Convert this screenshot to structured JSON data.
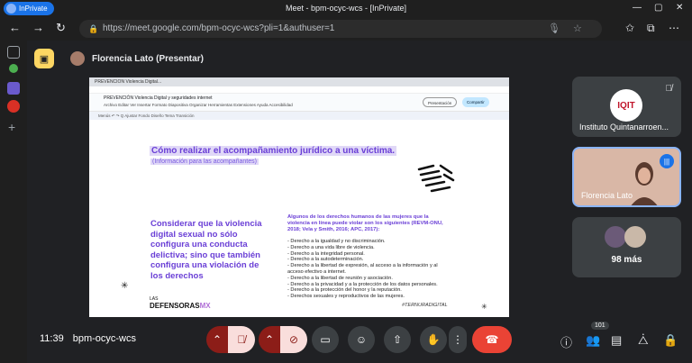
{
  "browser": {
    "inprivate_label": "InPrivate",
    "window_title": "Meet - bpm-ocyc-wcs - [InPrivate]",
    "url": "https://meet.google.com/bpm-ocyc-wcs?pli=1&authuser=1"
  },
  "meet": {
    "presenter_label": "Florencia Lato (Presentar)",
    "meeting_time": "11:39",
    "meeting_code": "bpm-ocyc-wcs",
    "participants_badge": "101",
    "tiles": [
      {
        "name": "Instituto Quintanarroen...",
        "logo_text": "IQIT"
      },
      {
        "name": "Florencia Lato"
      },
      {
        "more_label": "98 más"
      }
    ]
  },
  "shared_screen": {
    "tab_title": "PREVENCION Violencia Digital...",
    "doc_title": "PREVENCIÓN Violencia Digital y seguridades internet",
    "menu": "Archivo  Editar  Ver  Insertar  Formato  Diapositiva  Organizar  Herramientas  Extensiones  Ayuda  Accesibilidad",
    "present_button": "Presentación",
    "share_button": "Compartir",
    "format_bar": "Menús   ↶ ↷   Q   Ajustar   Fondo   Diseño   Tema   Transición",
    "slide": {
      "title": "Cómo realizar el acompañamiento jurídico a una víctima.",
      "subtitle": "(Información para las acompañantes)",
      "left_text": "Considerar que la violencia digital sexual no sólo configura una conducta delictiva; sino que también configura una violación de los derechos",
      "right_heading": "Algunos de los derechos humanos de las mujeres que la violencia en línea puede violar son los siguientes (REVM-ONU, 2018; Vela y Smith, 2016; APC, 2017):",
      "rights": [
        "- Derecho a la igualdad y no discriminación.",
        "- Derecho a una vida libre de violencia.",
        "- Derecho a la integridad personal.",
        "- Derecho a la autodeterminación.",
        "- Derecho a la libertad de expresión, al acceso a la información y al acceso efectivo a internet.",
        "- Derecho a la libertad de reunión y asociación.",
        "- Derecho a la privacidad y a la protección de los datos personales.",
        "- Derecho a la protección del honor y la reputación.",
        "- Derechos sexuales y reproductivos de las mujeres."
      ],
      "brand_top": "LAS",
      "brand_main": "DEFENSORAS",
      "brand_mx": "MX",
      "hashtag": "#TERNURADIGITAL"
    }
  }
}
